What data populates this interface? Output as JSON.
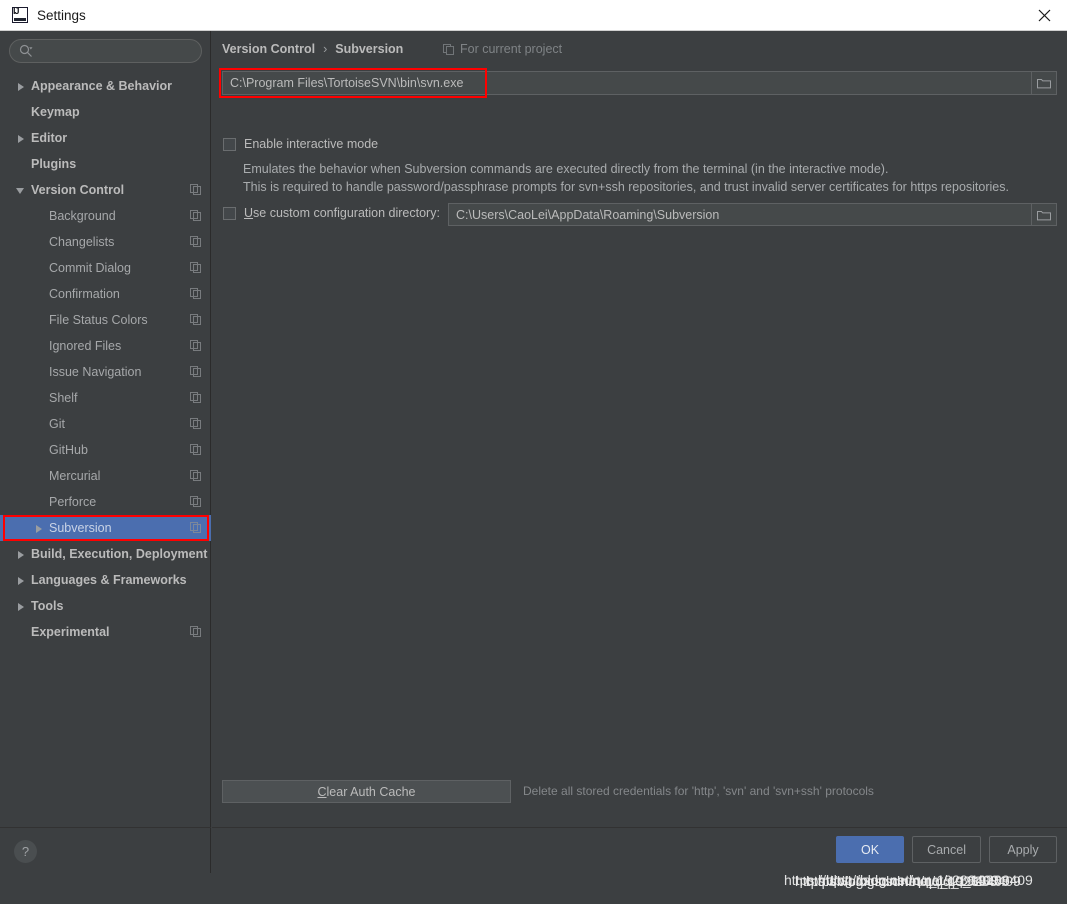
{
  "window": {
    "title": "Settings",
    "app_icon": "intellij-idea-icon",
    "close_icon": "close-icon"
  },
  "sidebar": {
    "search": {
      "placeholder": "",
      "value": "",
      "icon": "search-icon"
    },
    "help_label": "?",
    "items": [
      {
        "label": "Appearance & Behavior",
        "arrow": "collapsed",
        "level": "top",
        "copy": false,
        "selected": false
      },
      {
        "label": "Keymap",
        "arrow": "none",
        "level": "top",
        "copy": false,
        "selected": false
      },
      {
        "label": "Editor",
        "arrow": "collapsed",
        "level": "top",
        "copy": false,
        "selected": false
      },
      {
        "label": "Plugins",
        "arrow": "none",
        "level": "top",
        "copy": false,
        "selected": false
      },
      {
        "label": "Version Control",
        "arrow": "expanded",
        "level": "top",
        "copy": true,
        "selected": false
      },
      {
        "label": "Background",
        "arrow": "none",
        "level": "child",
        "copy": true,
        "selected": false
      },
      {
        "label": "Changelists",
        "arrow": "none",
        "level": "child",
        "copy": true,
        "selected": false
      },
      {
        "label": "Commit Dialog",
        "arrow": "none",
        "level": "child",
        "copy": true,
        "selected": false
      },
      {
        "label": "Confirmation",
        "arrow": "none",
        "level": "child",
        "copy": true,
        "selected": false
      },
      {
        "label": "File Status Colors",
        "arrow": "none",
        "level": "child",
        "copy": true,
        "selected": false
      },
      {
        "label": "Ignored Files",
        "arrow": "none",
        "level": "child",
        "copy": true,
        "selected": false
      },
      {
        "label": "Issue Navigation",
        "arrow": "none",
        "level": "child",
        "copy": true,
        "selected": false
      },
      {
        "label": "Shelf",
        "arrow": "none",
        "level": "child",
        "copy": true,
        "selected": false
      },
      {
        "label": "Git",
        "arrow": "none",
        "level": "child",
        "copy": true,
        "selected": false
      },
      {
        "label": "GitHub",
        "arrow": "none",
        "level": "child",
        "copy": true,
        "selected": false
      },
      {
        "label": "Mercurial",
        "arrow": "none",
        "level": "child",
        "copy": true,
        "selected": false
      },
      {
        "label": "Perforce",
        "arrow": "none",
        "level": "child",
        "copy": true,
        "selected": false
      },
      {
        "label": "Subversion",
        "arrow": "collapsed",
        "level": "child",
        "copy": true,
        "selected": true
      },
      {
        "label": "Build, Execution, Deployment",
        "arrow": "collapsed",
        "level": "top",
        "copy": false,
        "selected": false
      },
      {
        "label": "Languages & Frameworks",
        "arrow": "collapsed",
        "level": "top",
        "copy": false,
        "selected": false
      },
      {
        "label": "Tools",
        "arrow": "collapsed",
        "level": "top",
        "copy": false,
        "selected": false
      },
      {
        "label": "Experimental",
        "arrow": "none",
        "level": "top",
        "copy": true,
        "selected": false
      }
    ]
  },
  "content": {
    "breadcrumb": {
      "root": "Version Control",
      "separator": "›",
      "current": "Subversion"
    },
    "scope_label": "For current project",
    "scope_icon": "copy-icon",
    "path_field": {
      "value": "C:\\Program Files\\TortoiseSVN\\bin\\svn.exe",
      "browse_icon": "folder-icon"
    },
    "interactive": {
      "checkbox_label": "Enable interactive mode",
      "checked": false,
      "description_line1": "Emulates the behavior when Subversion commands are executed directly from the terminal (in the interactive mode).",
      "description_line2": "This is required to handle password/passphrase prompts for svn+ssh repositories, and trust invalid server certificates for https repositories."
    },
    "custom_config": {
      "checkbox_label_underlined": "U",
      "checkbox_label_rest": "se custom configuration directory:",
      "checked": false,
      "value": "C:\\Users\\CaoLei\\AppData\\Roaming\\Subversion",
      "browse_icon": "folder-icon"
    },
    "clear_auth": {
      "label_underlined": "C",
      "label_rest": "lear Auth Cache",
      "description": "Delete all stored credentials for 'http', 'svn' and 'svn+ssh' protocols"
    }
  },
  "dialog_buttons": [
    {
      "label": "OK",
      "style": "primary"
    },
    {
      "label": "Cancel",
      "style": "normal"
    },
    {
      "label": "Apply",
      "style": "normal"
    }
  ],
  "watermark": {
    "lines": [
      "https://blog.csdn.net/qq_19288409",
      "https://blog.csdn.net/qq_19288409",
      "https://blog.csdn.net/qq_19288409",
      "https://blog.csdn.net/qq_19288409"
    ]
  },
  "colors": {
    "window_bg": "#3c3f41",
    "titlebar_bg": "#ffffff",
    "field_bg": "#45494a",
    "selection_blue": "#4b6eaf",
    "annotation_red": "#ff0000",
    "text_primary": "#bbbbbb",
    "text_muted": "#84878a"
  }
}
